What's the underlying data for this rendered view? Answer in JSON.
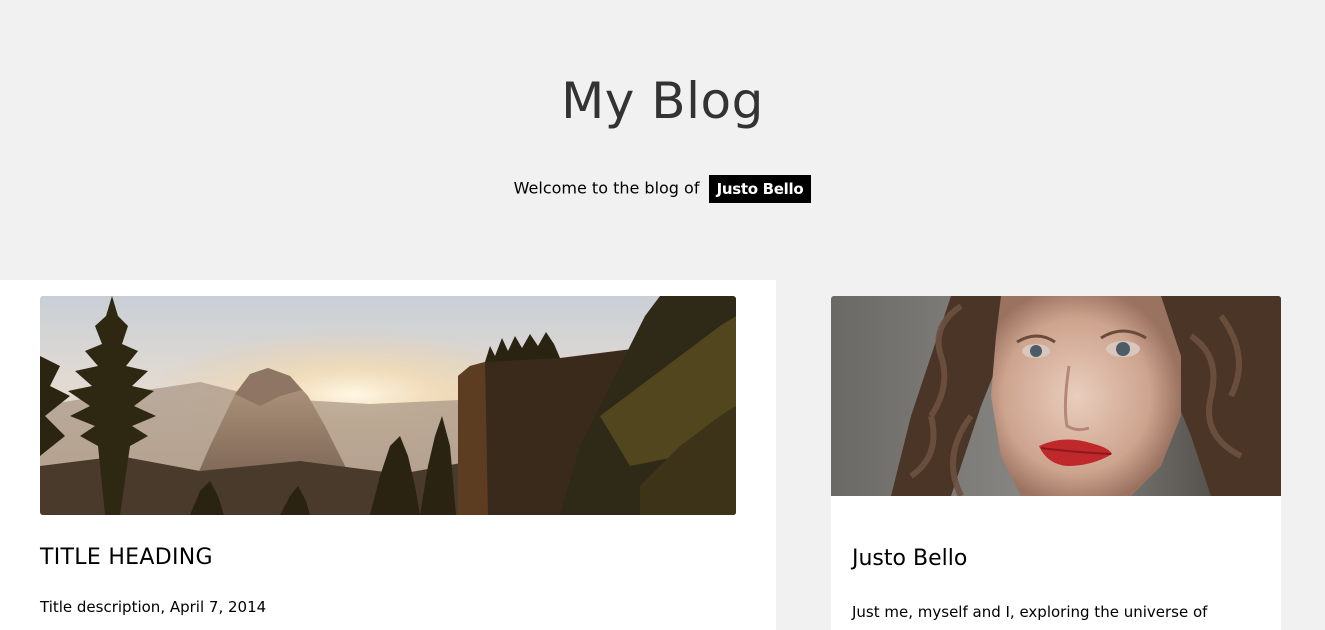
{
  "header": {
    "title": "My Blog",
    "welcome_text": "Welcome to the blog of",
    "author_badge": "Justo Bello"
  },
  "post": {
    "image_icon": "landscape-photo",
    "title": "TITLE HEADING",
    "description": "Title description, April 7, 2014"
  },
  "about": {
    "image_icon": "portrait-photo",
    "name": "Justo Bello",
    "text": "Just me, myself and I, exploring the universe of"
  }
}
